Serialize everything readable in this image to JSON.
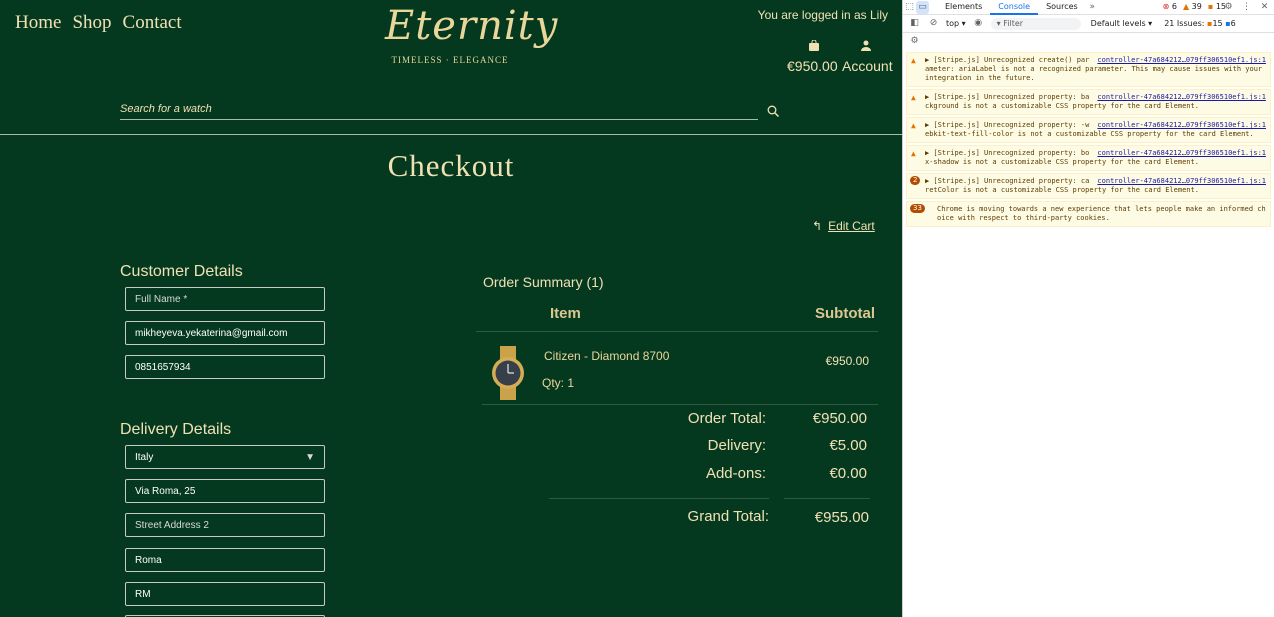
{
  "site": {
    "nav": [
      "Home",
      "Shop",
      "Contact"
    ],
    "logo_text": "Eternity",
    "logo_tagline": "TIMELESS · ELEGANCE",
    "logged_in": "You are logged in as Lily",
    "cart_total": "€950.00",
    "account": "Account",
    "search_placeholder": "Search for a watch",
    "page_title": "Checkout",
    "edit_cart": "Edit Cart",
    "customer_heading": "Customer Details",
    "full_name_placeholder": "Full Name *",
    "email_value": "mikheyeva.yekaterina@gmail.com",
    "phone_value": "0851657934",
    "delivery_heading": "Delivery Details",
    "country_value": "Italy",
    "street1_value": "Via Roma, 25",
    "street2_placeholder": "Street Address 2",
    "city_value": "Roma",
    "county_value": "RM",
    "summary_heading": "Order Summary (1)",
    "col_item": "Item",
    "col_subtotal": "Subtotal",
    "product_name": "Citizen - Diamond 8700",
    "product_qty": "Qty: 1",
    "product_price": "€950.00",
    "order_total_label": "Order Total:",
    "order_total_value": "€950.00",
    "delivery_label": "Delivery:",
    "delivery_value": "€5.00",
    "addons_label": "Add-ons:",
    "addons_value": "€0.00",
    "grand_total_label": "Grand Total:",
    "grand_total_value": "€955.00"
  },
  "devtools": {
    "tabs": [
      "Elements",
      "Console",
      "Sources"
    ],
    "active_tab": "Console",
    "error_count": "6",
    "warning_count": "39",
    "issue_count": "15",
    "context": "top",
    "filter_placeholder": "Filter",
    "levels": "Default levels",
    "issues_label": "21 Issues:",
    "issues_warn": "15",
    "issues_info": "6",
    "messages": [
      {
        "text": "▶ [Stripe.js] Unrecognized create() parameter: ariaLabel is not a recognized parameter. This may cause issues with your integration in the future.",
        "src": "controller-47a684212…079ff306510ef1.js:1"
      },
      {
        "text": "▶ [Stripe.js] Unrecognized property: background is not a customizable CSS property for the card Element.",
        "src": "controller-47a684212…079ff306510ef1.js:1"
      },
      {
        "text": "▶ [Stripe.js] Unrecognized property: -webkit-text-fill-color is not a customizable CSS property for the card Element.",
        "src": "controller-47a684212…079ff306510ef1.js:1"
      },
      {
        "text": "▶ [Stripe.js] Unrecognized property: box-shadow is not a customizable CSS property for the card Element.",
        "src": "controller-47a684212…079ff306510ef1.js:1"
      },
      {
        "text": "▶ [Stripe.js] Unrecognized property: caretColor is not a customizable CSS property for the card Element.",
        "src": "controller-47a684212…079ff306510ef1.js:1",
        "count": "2"
      },
      {
        "text": "Chrome is moving towards a new experience that lets people make an informed choice with respect to third-party cookies.",
        "src": "",
        "count": "33"
      }
    ]
  },
  "colors": {
    "site_bg": "#05391f",
    "gold": "#f0e1b4"
  }
}
